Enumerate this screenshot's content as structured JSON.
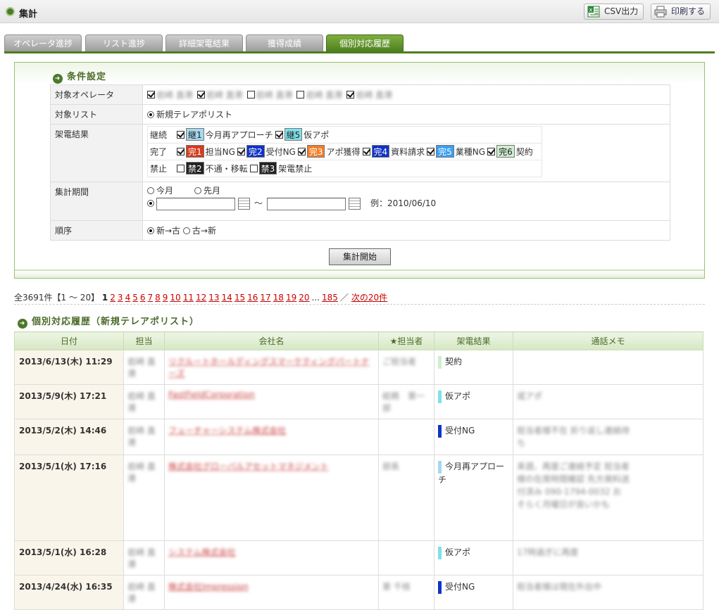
{
  "header": {
    "title": "集計",
    "csv_label": "CSV出力",
    "print_label": "印刷する"
  },
  "tabs": [
    "オペレータ進捗",
    "リスト進捗",
    "詳細架電結果",
    "獲得成績",
    "個別対応履歴"
  ],
  "conditions": {
    "title": "条件設定",
    "operator_label": "対象オペレータ",
    "operators": [
      "岩崎 直港",
      "岩崎 直港",
      "岩崎 直港",
      "岩崎 直港",
      "岩崎 直港"
    ],
    "operators_checked": [
      true,
      true,
      false,
      false,
      true
    ],
    "list_label": "対象リスト",
    "list_value": "新規テレアポリスト",
    "result_label": "架電結果",
    "result_rows": [
      {
        "group": "継続",
        "items": [
          {
            "badge": "継1",
            "label": "今月再アプローチ",
            "color": "#a6d8ef",
            "text_color": "#222",
            "checked": true
          },
          {
            "badge": "継5",
            "label": "仮アポ",
            "color": "#7fe0e8",
            "text_color": "#222",
            "checked": true
          }
        ]
      },
      {
        "group": "完了",
        "items": [
          {
            "badge": "完1",
            "label": "担当NG",
            "color": "#d63b1f",
            "text_color": "#fff",
            "checked": true
          },
          {
            "badge": "完2",
            "label": "受付NG",
            "color": "#1033c8",
            "text_color": "#fff",
            "checked": true
          },
          {
            "badge": "完3",
            "label": "アポ獲得",
            "color": "#f07f2a",
            "text_color": "#fff",
            "checked": true
          },
          {
            "badge": "完4",
            "label": "資料請求",
            "color": "#1032c4",
            "text_color": "#fff",
            "checked": true
          },
          {
            "badge": "完5",
            "label": "業種NG",
            "color": "#3a9ff0",
            "text_color": "#fff",
            "checked": true
          },
          {
            "badge": "完6",
            "label": "契約",
            "color": "#cdeecf",
            "text_color": "#222",
            "checked": true
          }
        ]
      },
      {
        "group": "禁止",
        "items": [
          {
            "badge": "禁2",
            "label": "不通・移転",
            "color": "#222",
            "text_color": "#fff",
            "checked": false
          },
          {
            "badge": "禁3",
            "label": "架電禁止",
            "color": "#222",
            "text_color": "#fff",
            "checked": false
          }
        ]
      }
    ],
    "period_label": "集計期間",
    "period_this": "今月",
    "period_last": "先月",
    "period_from": "",
    "period_to": "",
    "period_tilde": "〜",
    "period_example": "例：2010/06/10",
    "order_label": "順序",
    "order_new": "新→古",
    "order_old": "古→新",
    "start_label": "集計開始"
  },
  "pager": {
    "total": "全3691件",
    "range": "【1 〜 20】",
    "current": "1",
    "pages": [
      "2",
      "3",
      "4",
      "5",
      "6",
      "7",
      "8",
      "9",
      "10",
      "11",
      "12",
      "13",
      "14",
      "15",
      "16",
      "17",
      "18",
      "19",
      "20"
    ],
    "ellipsis": "...",
    "last": "185",
    "slash": "／",
    "next": "次の20件"
  },
  "history": {
    "title": "個別対応履歴（新規テレアポリスト）",
    "columns": [
      "日付",
      "担当",
      "会社名",
      "★担当者",
      "架電結果",
      "通話メモ"
    ],
    "rows": [
      {
        "date": "2013/6/13(木) 11:29",
        "staff": "岩崎 直港",
        "company": "リクルートホールディングスマーケティングパートナーズ",
        "person": "ご担当者",
        "result": "契約",
        "result_color": "#cdeecf",
        "memo": ""
      },
      {
        "date": "2013/5/9(木) 17:21",
        "staff": "岩崎 直港",
        "company": "FastFieldCorporation",
        "person": "総務　第一部",
        "result": "仮アポ",
        "result_color": "#7fe0e8",
        "memo": "或アポ"
      },
      {
        "date": "2013/5/2(木) 14:46",
        "staff": "岩崎 直港",
        "company": "フューチャーシステム株式会社",
        "person": "",
        "result": "受付NG",
        "result_color": "#1033c8",
        "memo": "担当者様不在 折り返し連絡待ち"
      },
      {
        "date": "2013/5/1(水) 17:16",
        "staff": "岩崎 直港",
        "company": "株式会社グローバルアセットマネジメント",
        "person": "部長",
        "result": "今月再アプローチ",
        "result_color": "#a6d8ef",
        "memo": "来週、再度ご連絡予定 担当者様の在席時間確認 先方資料送付済み 090-1794-0032 おそらく月曜日が良いかも"
      },
      {
        "date": "2013/5/1(水) 16:28",
        "staff": "岩崎 直港",
        "company": "システム株式会社",
        "person": "",
        "result": "仮アポ",
        "result_color": "#7fe0e8",
        "memo": "17時過ぎに再度"
      },
      {
        "date": "2013/4/24(水) 16:35",
        "staff": "岩崎 直港",
        "company": "株式会社Impression",
        "person": "第 千枝",
        "result": "受付NG",
        "result_color": "#1033c8",
        "memo": "担当者様は現在外出中"
      }
    ]
  }
}
